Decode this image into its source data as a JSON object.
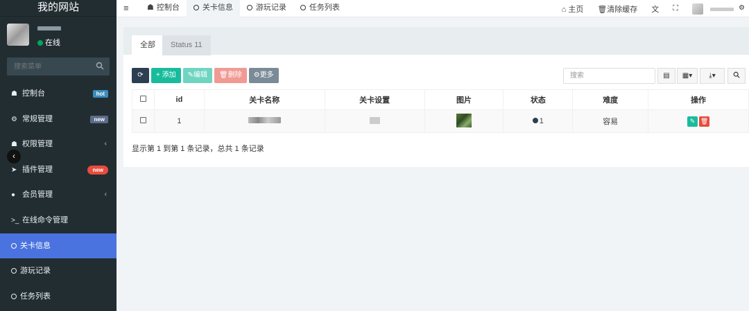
{
  "sidebar": {
    "brand": "我的网站",
    "status": "在线",
    "search_placeholder": "搜索菜单",
    "items": [
      {
        "label": "控制台",
        "icon": "dashboard-icon",
        "glyph": "⚙",
        "badge": "hot"
      },
      {
        "label": "常规管理",
        "icon": "cogs-icon",
        "glyph": "⚙",
        "badge": "new"
      },
      {
        "label": "权限管理",
        "icon": "users-icon",
        "glyph": "☗",
        "chevron": "‹"
      },
      {
        "label": "插件管理",
        "icon": "rocket-icon",
        "glyph": "➤",
        "badge": "new"
      },
      {
        "label": "会员管理",
        "icon": "user-circle-icon",
        "glyph": "●",
        "chevron": "‹"
      },
      {
        "label": "在线命令管理",
        "icon": "terminal-icon",
        "glyph": ">_"
      },
      {
        "label": "关卡信息",
        "icon": "circle-icon",
        "glyph": "○",
        "active": true
      },
      {
        "label": "游玩记录",
        "icon": "circle-icon",
        "glyph": "○"
      },
      {
        "label": "任务列表",
        "icon": "circle-icon",
        "glyph": "○"
      }
    ]
  },
  "topbar": {
    "tabs": [
      {
        "label": "控制台"
      },
      {
        "label": "关卡信息"
      },
      {
        "label": "游玩记录"
      },
      {
        "label": "任务列表"
      }
    ],
    "home": "主页",
    "clear_cache": "清除缓存"
  },
  "panel": {
    "tab_all": "全部",
    "tab_status": "Status 11",
    "buttons": {
      "add": "添加",
      "edit": "编辑",
      "delete": "删除",
      "more": "更多"
    },
    "search_placeholder": "搜索",
    "columns": [
      "id",
      "关卡名称",
      "关卡设置",
      "图片",
      "状态",
      "难度",
      "操作"
    ],
    "rows": [
      {
        "id": "1",
        "status": "1",
        "difficulty": "容易"
      }
    ],
    "footer": "显示第 1 到第 1 条记录，总共 1 条记录"
  }
}
